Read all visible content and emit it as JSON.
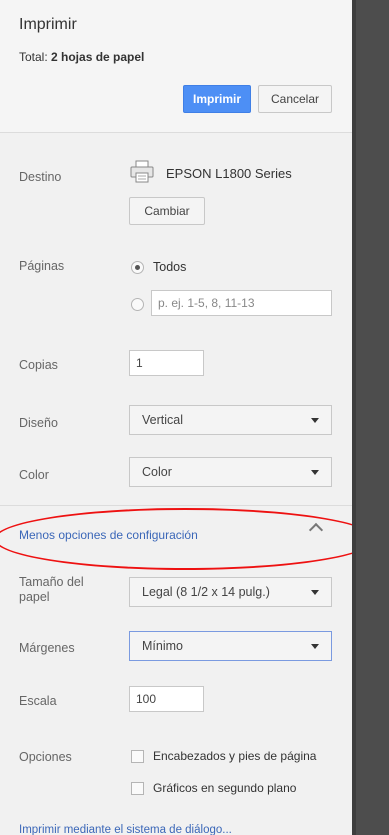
{
  "print_dialog": {
    "title": "Imprimir",
    "summary": {
      "prefix": "Total: ",
      "value": "2 hojas de papel"
    },
    "buttons": {
      "print": "Imprimir",
      "cancel": "Cancelar"
    }
  },
  "destination": {
    "label": "Destino",
    "printer_name": "EPSON L1800 Series",
    "change_button": "Cambiar"
  },
  "pages": {
    "label": "Páginas",
    "option_all": "Todos",
    "custom_placeholder": "p. ej. 1-5, 8, 11-13"
  },
  "copies": {
    "label": "Copias",
    "value": "1"
  },
  "layout": {
    "label": "Diseño",
    "value": "Vertical"
  },
  "color": {
    "label": "Color",
    "value": "Color"
  },
  "settings_toggle": {
    "label": "Menos opciones de configuración"
  },
  "paper_size": {
    "label_line1": "Tamaño del",
    "label_line2": "papel",
    "value": "Legal (8 1/2 x 14 pulg.)"
  },
  "margins": {
    "label": "Márgenes",
    "value": "Mínimo"
  },
  "scale": {
    "label": "Escala",
    "value": "100"
  },
  "options": {
    "label": "Opciones",
    "headers_footers": "Encabezados y pies de página",
    "background_graphics": "Gráficos en segundo plano"
  },
  "system_dialog_link": "Imprimir mediante el sistema de diálogo..."
}
